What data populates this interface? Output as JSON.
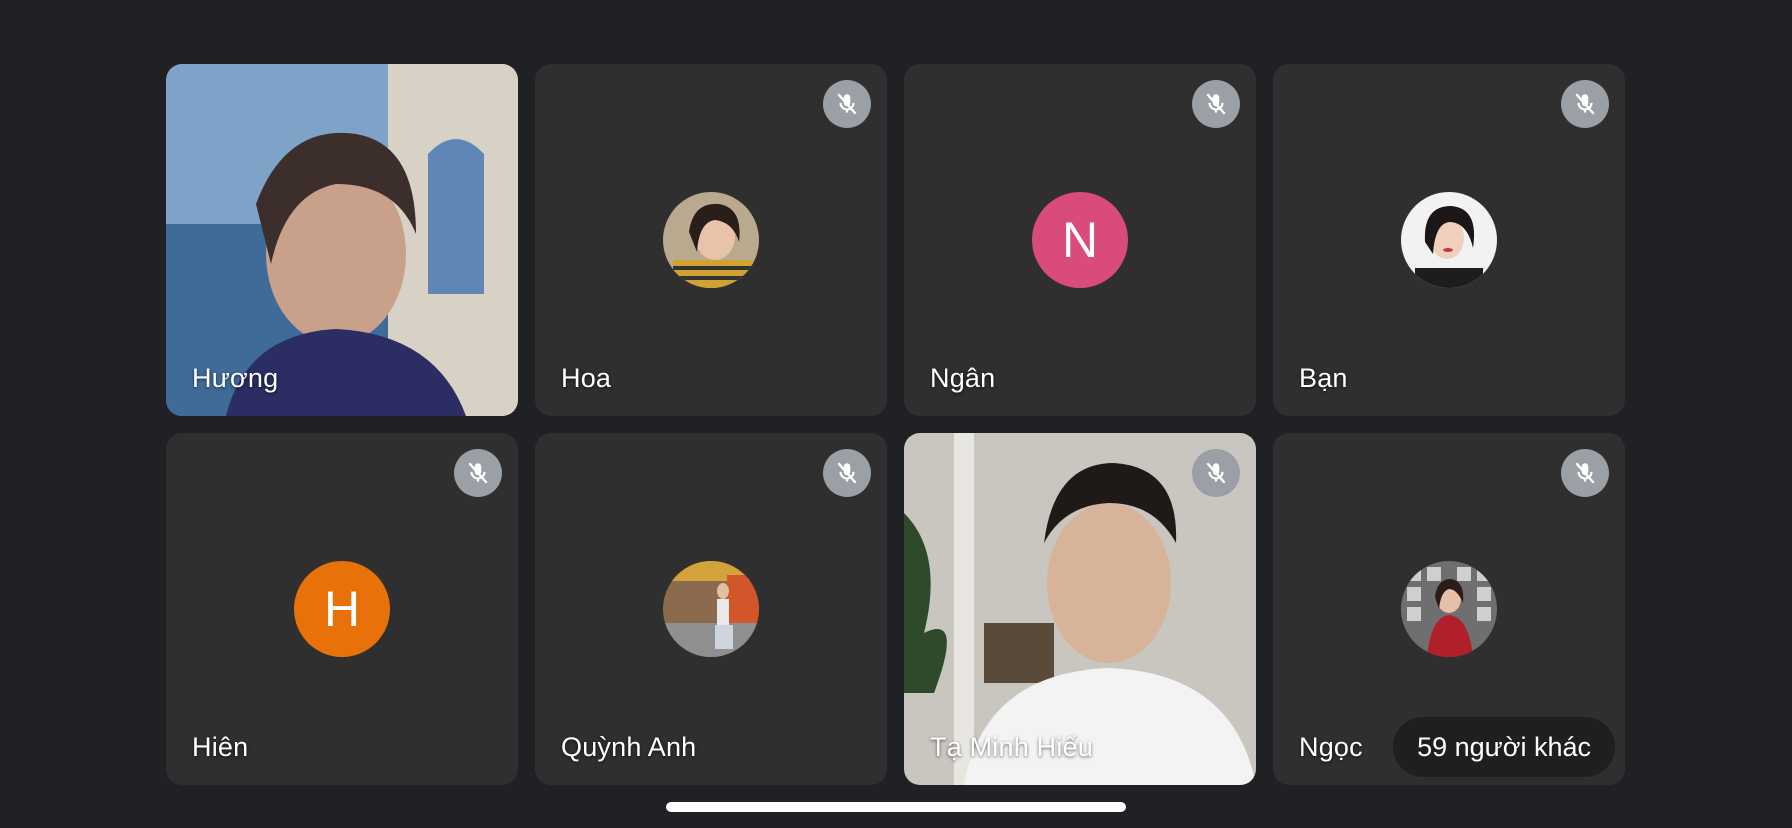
{
  "participants": [
    {
      "name": "Hương",
      "type": "video",
      "muted": false
    },
    {
      "name": "Hoa",
      "type": "photo",
      "muted": true
    },
    {
      "name": "Ngân",
      "type": "letter",
      "initial": "N",
      "color": "#d94b7d",
      "muted": true
    },
    {
      "name": "Bạn",
      "type": "photo",
      "muted": true
    },
    {
      "name": "Hiên",
      "type": "letter",
      "initial": "H",
      "color": "#e8710a",
      "muted": true
    },
    {
      "name": "Quỳnh Anh",
      "type": "photo",
      "muted": true
    },
    {
      "name": "Tạ Minh Hiếu",
      "type": "video",
      "muted": true
    },
    {
      "name": "Ngọc",
      "type": "photo",
      "muted": true
    }
  ],
  "others_label": "59 người khác",
  "icons": {
    "muted": "mic-off-icon"
  }
}
